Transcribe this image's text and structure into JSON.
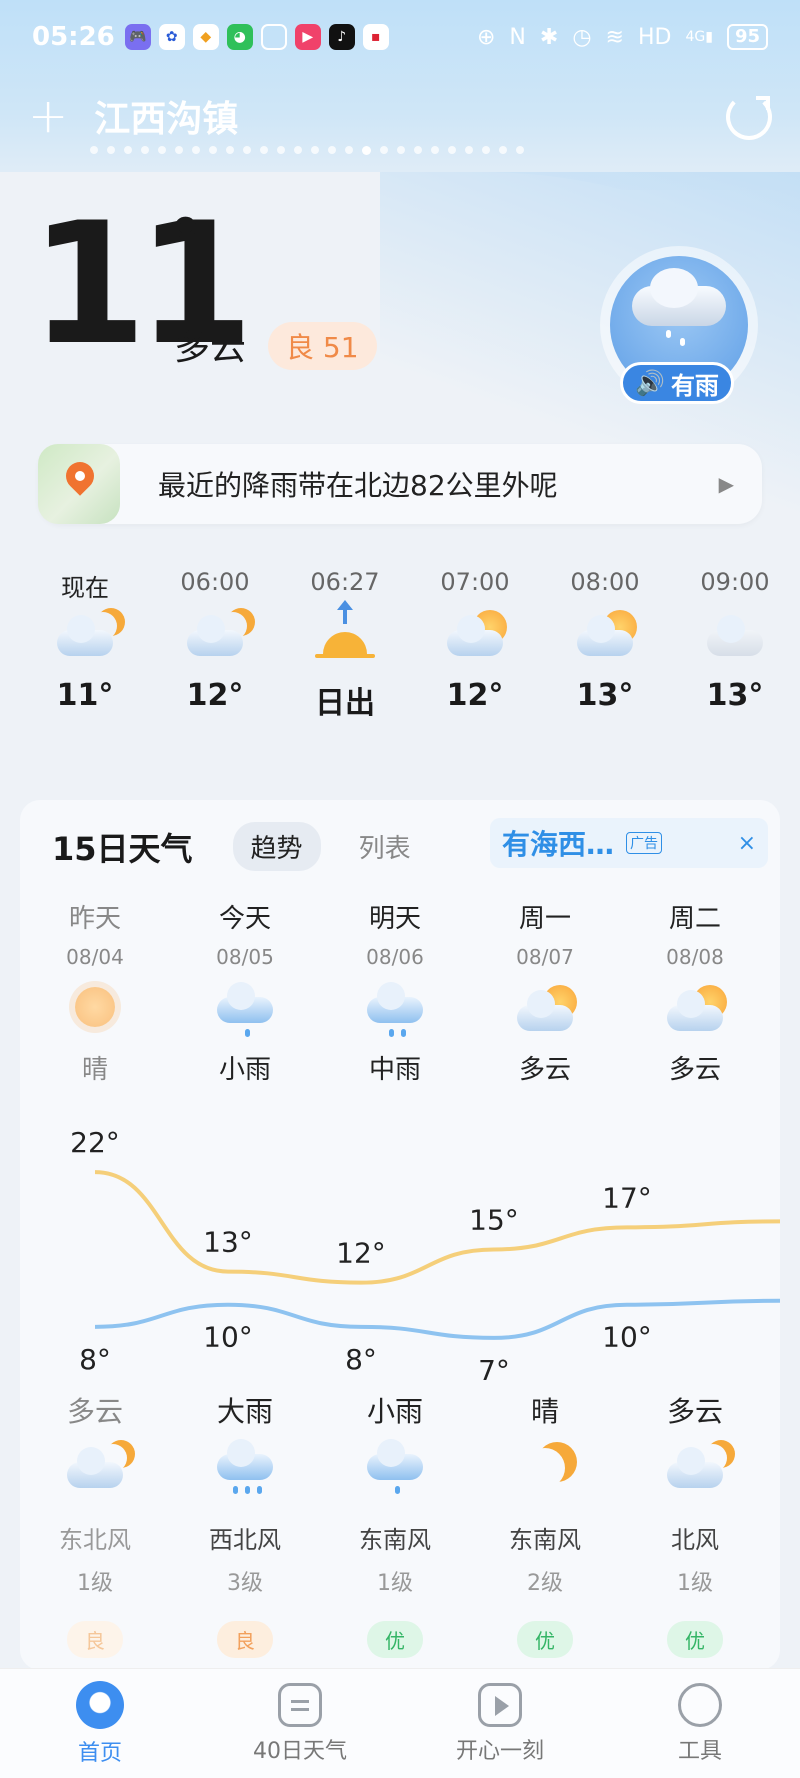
{
  "status_bar": {
    "time": "05:26",
    "network": "HD",
    "signal": "4G",
    "battery": "95"
  },
  "header": {
    "add_label": "+",
    "city": "江西沟镇",
    "page_count": 26,
    "active_page": 16
  },
  "current": {
    "temperature": "11",
    "degree": "°",
    "condition": "多云",
    "aqi": "良 51",
    "rain_badge": "有雨"
  },
  "alert": {
    "text": "最近的降雨带在北边82公里外呢",
    "chevron": "▶"
  },
  "hourly": [
    {
      "time": "现在",
      "icon": "cloud-moon-icon",
      "value": "11°"
    },
    {
      "time": "06:00",
      "icon": "cloud-moon-icon",
      "value": "12°"
    },
    {
      "time": "06:27",
      "icon": "sunrise-icon",
      "value": "日出"
    },
    {
      "time": "07:00",
      "icon": "cloud-sun-icon",
      "value": "12°"
    },
    {
      "time": "08:00",
      "icon": "cloud-sun-icon",
      "value": "13°"
    },
    {
      "time": "09:00",
      "icon": "cloud-icon",
      "value": "13°"
    }
  ],
  "forecast": {
    "title": "15日天气",
    "tab_trend": "趋势",
    "tab_list": "列表",
    "ad_text": "有海西…",
    "ad_tag": "广告",
    "ad_close": "×",
    "days": [
      {
        "name": "昨天",
        "date": "08/04",
        "day_icon": "sunny-icon",
        "day_cond": "晴",
        "high": "22°",
        "low": "8°",
        "night_cond": "多云",
        "night_icon": "cloud-moon-icon",
        "wind_dir": "东北风",
        "wind_level": "1级",
        "quality": "良"
      },
      {
        "name": "今天",
        "date": "08/05",
        "day_icon": "light-rain-icon",
        "day_cond": "小雨",
        "high": "13°",
        "low": "10°",
        "night_cond": "大雨",
        "night_icon": "heavy-rain-icon",
        "wind_dir": "西北风",
        "wind_level": "3级",
        "quality": "良"
      },
      {
        "name": "明天",
        "date": "08/06",
        "day_icon": "moderate-rain-icon",
        "day_cond": "中雨",
        "high": "12°",
        "low": "8°",
        "night_cond": "小雨",
        "night_icon": "light-rain-icon",
        "wind_dir": "东南风",
        "wind_level": "1级",
        "quality": "优"
      },
      {
        "name": "周一",
        "date": "08/07",
        "day_icon": "cloud-sun-icon",
        "day_cond": "多云",
        "high": "15°",
        "low": "7°",
        "night_cond": "晴",
        "night_icon": "moon-icon",
        "wind_dir": "东南风",
        "wind_level": "2级",
        "quality": "优"
      },
      {
        "name": "周二",
        "date": "08/08",
        "day_icon": "cloud-sun-icon",
        "day_cond": "多云",
        "high": "17°",
        "low": "10°",
        "night_cond": "多云",
        "night_icon": "cloud-moon-icon",
        "wind_dir": "北风",
        "wind_level": "1级",
        "quality": "优"
      }
    ]
  },
  "colors": {
    "high_line": "#f5cf7a",
    "low_line": "#8ec3f0",
    "accent": "#3d8ef0",
    "aqi_good": "#f08a48",
    "aqi_excellent": "#34b566"
  },
  "bottom_nav": [
    {
      "label": "首页",
      "icon": "home-icon",
      "active": true
    },
    {
      "label": "40日天气",
      "icon": "calendar-icon",
      "active": false
    },
    {
      "label": "开心一刻",
      "icon": "play-icon",
      "active": false
    },
    {
      "label": "工具",
      "icon": "tools-icon",
      "active": false
    }
  ]
}
